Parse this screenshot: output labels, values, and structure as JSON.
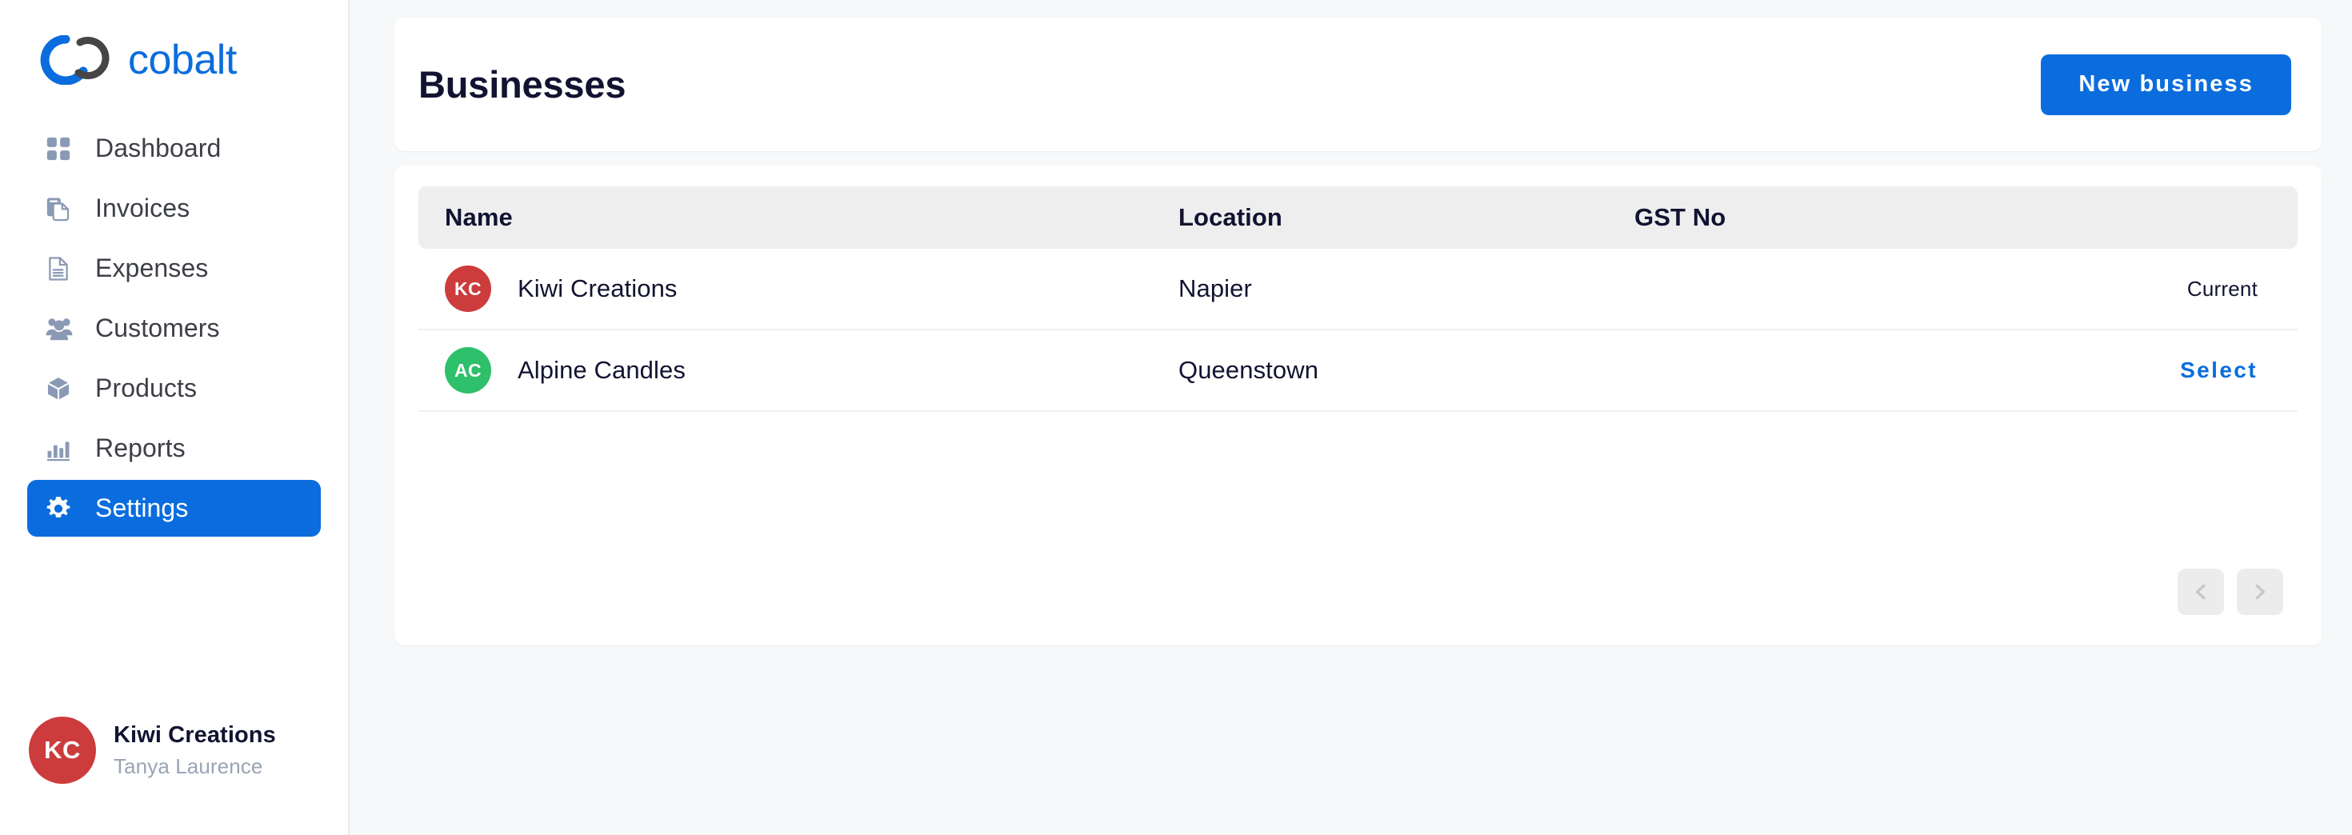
{
  "brand": {
    "name": "cobalt",
    "logo_blue": "#0b6ddd",
    "logo_dark": "#464646"
  },
  "sidebar": {
    "items": [
      {
        "label": "Dashboard",
        "icon": "grid-icon",
        "active": false
      },
      {
        "label": "Invoices",
        "icon": "invoices-icon",
        "active": false
      },
      {
        "label": "Expenses",
        "icon": "document-icon",
        "active": false
      },
      {
        "label": "Customers",
        "icon": "people-icon",
        "active": false
      },
      {
        "label": "Products",
        "icon": "cube-icon",
        "active": false
      },
      {
        "label": "Reports",
        "icon": "bar-chart-icon",
        "active": false
      },
      {
        "label": "Settings",
        "icon": "gear-icon",
        "active": true
      }
    ],
    "user": {
      "initials": "KC",
      "avatar_color": "#cc3c3c",
      "business": "Kiwi Creations",
      "person": "Tanya Laurence"
    }
  },
  "header": {
    "title": "Businesses",
    "new_business_label": "New business",
    "accent_color": "#0b6ddd"
  },
  "table": {
    "columns": [
      "Name",
      "Location",
      "GST No",
      ""
    ],
    "rows": [
      {
        "initials": "KC",
        "avatar_color": "#cc3c3c",
        "name": "Kiwi Creations",
        "location": "Napier",
        "gst_no": "",
        "action": "Current",
        "action_type": "status"
      },
      {
        "initials": "AC",
        "avatar_color": "#2ec06a",
        "name": "Alpine Candles",
        "location": "Queenstown",
        "gst_no": "",
        "action": "Select",
        "action_type": "link"
      }
    ]
  },
  "pagination": {
    "prev_icon": "chevron-left-icon",
    "next_icon": "chevron-right-icon"
  }
}
